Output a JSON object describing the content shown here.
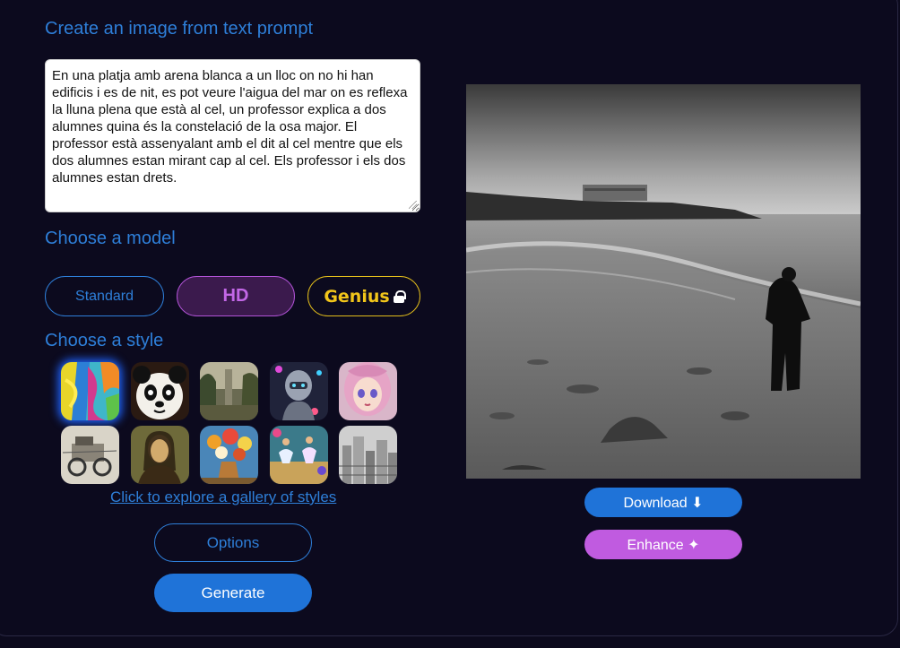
{
  "title": "Create an image from text prompt",
  "prompt": {
    "value": "En una platja amb arena blanca a un lloc on no hi han edificis i es de nit, es pot veure l'aigua del mar on es reflexa la lluna plena que està al cel, un professor explica a dos alumnes quina és la constelació de la osa major. El professor està assenyalant amb el dit al cel mentre que els dos alumnes estan mirant cap al cel. Els professor i els dos alumnes estan drets."
  },
  "model_section": {
    "heading": "Choose a model",
    "options": [
      {
        "label": "Standard",
        "selected": false
      },
      {
        "label": "HD",
        "selected": true
      },
      {
        "label": "Genius",
        "locked": true,
        "icon": "lock-icon"
      }
    ]
  },
  "style_section": {
    "heading": "Choose a style",
    "gallery_link": "Click to explore a gallery of styles",
    "selected_index": 0
  },
  "buttons": {
    "options": "Options",
    "generate": "Generate",
    "download": "Download ⬇",
    "enhance": "Enhance ✦"
  },
  "colors": {
    "accent_blue": "#2e7fd9",
    "accent_purple": "#c05be0",
    "accent_gold": "#f1c51a",
    "background": "#0c0a1d"
  }
}
